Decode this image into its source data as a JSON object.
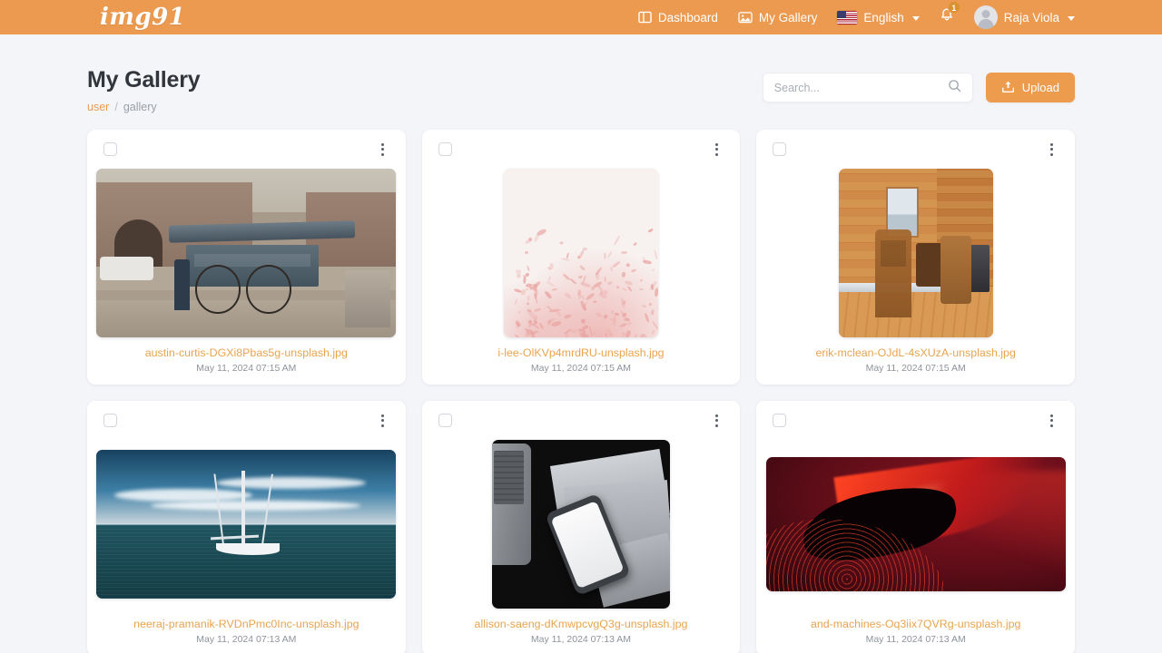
{
  "navbar": {
    "brand": "img91",
    "items": [
      {
        "label": "Dashboard",
        "icon": "dashboard-icon"
      },
      {
        "label": "My Gallery",
        "icon": "gallery-icon"
      },
      {
        "label": "English",
        "icon": "us-flag-icon"
      }
    ],
    "notification_count": "1",
    "user": {
      "name": "Raja Viola"
    }
  },
  "header": {
    "title": "My Gallery",
    "breadcrumb": {
      "root": "user",
      "separator": "/",
      "current": "gallery"
    },
    "search": {
      "value": "",
      "placeholder": "Search..."
    },
    "upload_label": "Upload"
  },
  "colors": {
    "brand_orange": "#eb9a4f",
    "upload_button": "#ed9c4e",
    "filename_link": "#e8a44f",
    "page_background": "#f4f5f9",
    "card_background": "#ffffff",
    "title_text": "#32353b",
    "muted_text": "#8e939b"
  },
  "gallery": {
    "items": [
      {
        "filename": "austin-curtis-DGXi8Pbas5g-unsplash.jpg",
        "date": "May 11, 2024 07:15 AM",
        "thumb_description": "street-tea-stall-cart",
        "art_class": "art-street",
        "thumb_w": 330,
        "thumb_h": 186,
        "selected": false
      },
      {
        "filename": "i-lee-OlKVp4mrdRU-unsplash.jpg",
        "date": "May 11, 2024 07:15 AM",
        "thumb_description": "pink-botanical-branches",
        "art_class": "art-botanical",
        "thumb_w": 170,
        "thumb_h": 186,
        "selected": false
      },
      {
        "filename": "erik-mclean-OJdL-4sXUzA-unsplash.jpg",
        "date": "May 11, 2024 07:15 AM",
        "thumb_description": "wooden-cabin-interior",
        "art_class": "art-cabin",
        "thumb_w": 170,
        "thumb_h": 186,
        "selected": false
      },
      {
        "filename": "neeraj-pramanik-RVDnPmc0Inc-unsplash.jpg",
        "date": "May 11, 2024 07:13 AM",
        "thumb_description": "sailboat-on-sea",
        "art_class": "art-sea",
        "thumb_w": 330,
        "thumb_h": 164,
        "selected": false
      },
      {
        "filename": "allison-saeng-dKmwpcvgQ3g-unsplash.jpg",
        "date": "May 11, 2024 07:13 AM",
        "thumb_description": "phone-and-papers-dark-desk",
        "art_class": "art-desk",
        "thumb_w": 196,
        "thumb_h": 186,
        "selected": false
      },
      {
        "filename": "and-machines-Oq3iix7QVRg-unsplash.jpg",
        "date": "May 11, 2024 07:13 AM",
        "thumb_description": "red-abstract-waves",
        "art_class": "art-red",
        "thumb_w": 330,
        "thumb_h": 148,
        "selected": false
      }
    ]
  }
}
